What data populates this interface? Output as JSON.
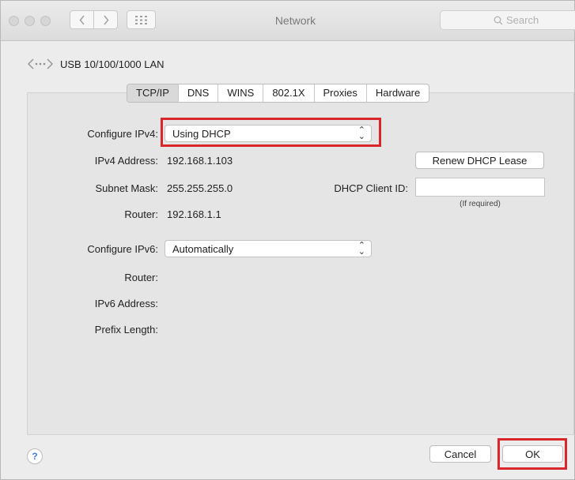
{
  "window": {
    "title": "Network"
  },
  "search": {
    "placeholder": "Search"
  },
  "interface": {
    "name": "USB 10/100/1000 LAN"
  },
  "tabs": [
    "TCP/IP",
    "DNS",
    "WINS",
    "802.1X",
    "Proxies",
    "Hardware"
  ],
  "ipv4": {
    "configure_label": "Configure IPv4:",
    "configure_value": "Using DHCP",
    "address_label": "IPv4 Address:",
    "address": "192.168.1.103",
    "subnet_label": "Subnet Mask:",
    "subnet": "255.255.255.0",
    "router_label": "Router:",
    "router": "192.168.1.1",
    "renew_button": "Renew DHCP Lease",
    "client_id_label": "DHCP Client ID:",
    "client_id_value": "",
    "client_id_hint": "(If required)"
  },
  "ipv6": {
    "configure_label": "Configure IPv6:",
    "configure_value": "Automatically",
    "router_label": "Router:",
    "address_label": "IPv6 Address:",
    "prefix_label": "Prefix Length:"
  },
  "footer": {
    "help": "?",
    "cancel": "Cancel",
    "ok": "OK"
  },
  "colors": {
    "highlight": "#d9262c",
    "help_accent": "#3d7fe0"
  },
  "icons": {
    "interface": "network-interface-icon",
    "back": "chevron-left-icon",
    "forward": "chevron-right-icon",
    "grid": "grid-icon",
    "search": "search-icon",
    "select": "updown-arrows-icon"
  }
}
